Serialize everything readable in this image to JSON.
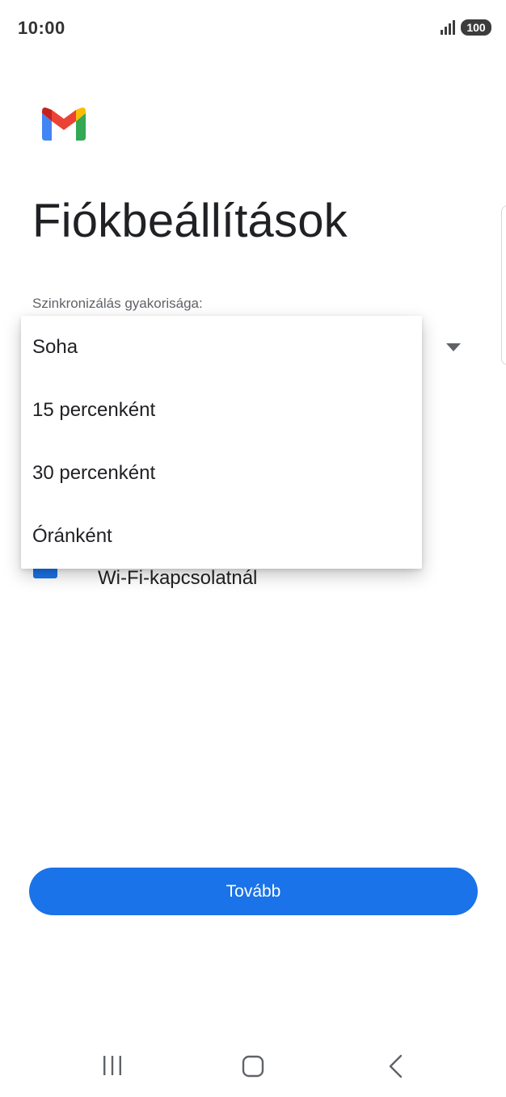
{
  "status_bar": {
    "time": "10:00",
    "battery": "100"
  },
  "app": {
    "logo": "gmail-logo"
  },
  "page": {
    "title": "Fiókbeállítások"
  },
  "sync": {
    "label": "Szinkronizálás gyakorisága:"
  },
  "dropdown": {
    "options": [
      "Soha",
      "15 percenként",
      "30 percenként",
      "Óránként"
    ]
  },
  "wifi_option": {
    "label": "Wi-Fi-kapcsolatnál",
    "checked": true
  },
  "actions": {
    "next_label": "Tovább"
  },
  "colors": {
    "primary": "#1a73e8",
    "text": "#202124",
    "muted": "#5f6368"
  },
  "nav": {
    "recents_icon": "recents-icon",
    "home_icon": "home-icon",
    "back_icon": "back-icon"
  }
}
